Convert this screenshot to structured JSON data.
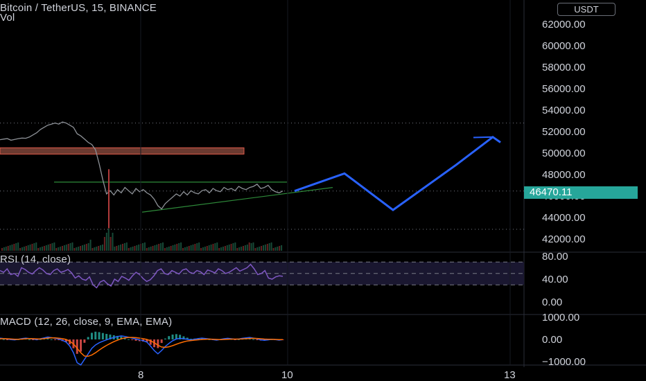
{
  "header": {
    "title": "Bitcoin / TetherUS, 15, BINANCE",
    "volume_label": "Vol",
    "currency_button": "USDT",
    "rsi_label": "RSI (14, close)",
    "macd_label": "MACD (12, 26, close, 9, EMA, EMA)"
  },
  "chart_data": [
    {
      "type": "line",
      "pane": "price",
      "y_ticks": [
        "62000.00",
        "60000.00",
        "58000.00",
        "56000.00",
        "54000.00",
        "52000.00",
        "50000.00",
        "48000.00",
        "46000.00",
        "44000.00",
        "42000.00"
      ],
      "ylim": [
        41500,
        63800
      ],
      "x_ticks": [
        "8",
        "10",
        "13"
      ],
      "last_price": "46470.11",
      "series": [
        {
          "values": [
            51250,
            51300,
            51350,
            51200,
            51280,
            51350,
            51400,
            51380,
            51500,
            51700,
            51900,
            52200,
            52400,
            52600,
            52700,
            52800,
            52700,
            52900,
            52800,
            52600,
            52400,
            51800,
            51600,
            51300,
            51000,
            50800,
            50300,
            49000,
            47500,
            46200,
            46500,
            46100,
            46600,
            46300,
            46800,
            46500,
            46200,
            46700,
            46400,
            46600,
            46300,
            46100,
            45700,
            45100,
            44800,
            45300,
            45600,
            45900,
            46200,
            46000,
            46400,
            46100,
            46500,
            46300,
            46200,
            46500,
            46600,
            46300,
            46700,
            46500,
            46400,
            46800,
            46600,
            46700,
            46500,
            46900,
            46700,
            46600,
            46800,
            46900,
            47100,
            46700,
            46800,
            47000,
            46600,
            46400,
            46300,
            46470
          ]
        }
      ],
      "projection": {
        "color": "#2962ff",
        "points": [
          [
            0,
            46470
          ],
          [
            1,
            48100
          ],
          [
            2,
            44700
          ],
          [
            3,
            48900
          ],
          [
            4,
            51500
          ],
          [
            5,
            51000
          ]
        ]
      },
      "levels": [
        {
          "value": 52800,
          "style": "dotted"
        },
        {
          "value": 46470,
          "style": "dotted"
        },
        {
          "value": 42900,
          "style": "dotted"
        },
        {
          "value": 47300,
          "style": "green"
        }
      ],
      "supply_zone": [
        50100,
        50300
      ],
      "trendline": [
        [
          0.2,
          44500
        ],
        [
          1,
          46800
        ]
      ]
    },
    {
      "type": "line",
      "pane": "rsi",
      "y_ticks": [
        "80.00",
        "40.00",
        "0.00"
      ],
      "band": [
        30,
        70
      ],
      "series": [
        {
          "values": [
            55,
            52,
            58,
            48,
            50,
            45,
            60,
            57,
            52,
            49,
            55,
            60,
            56,
            50,
            48,
            55,
            58,
            52,
            54,
            57,
            51,
            42,
            46,
            40,
            38,
            44,
            30,
            25,
            35,
            38,
            32,
            28,
            40,
            36,
            45,
            42,
            38,
            46,
            52,
            48,
            41,
            36,
            39,
            46,
            55,
            58,
            50,
            48,
            55,
            52,
            49,
            56,
            58,
            52,
            50,
            55,
            53,
            48,
            56,
            54,
            51,
            58,
            55,
            50,
            52,
            56,
            60,
            54,
            57,
            60,
            66,
            58,
            48,
            50,
            55,
            42,
            40,
            44,
            46,
            45
          ]
        }
      ]
    },
    {
      "type": "line",
      "pane": "macd",
      "y_ticks": [
        "1000.00",
        "0.00",
        "−1000.00"
      ],
      "ylim": [
        -1250,
        1250
      ],
      "series": [
        {
          "values": [
            60,
            40,
            20,
            -10,
            -20,
            10,
            40,
            60,
            40,
            20,
            -10,
            30,
            70,
            110,
            80,
            50,
            20,
            -40,
            -120,
            -300,
            -600,
            -1050,
            -1150,
            -900,
            -650,
            -400,
            -250,
            -150,
            -80,
            -20,
            40,
            90,
            130,
            160,
            130,
            100,
            60,
            20,
            -20,
            -60,
            -120,
            -300,
            -500,
            -650,
            -500,
            -320,
            -180,
            -60,
            20,
            50,
            30,
            10,
            -20,
            10,
            40,
            60,
            40,
            20,
            -10,
            -30,
            0,
            30,
            50,
            30,
            10,
            20,
            50,
            70,
            90,
            60,
            30,
            -20,
            -40,
            -20,
            10,
            -10,
            -30,
            -10
          ]
        },
        {
          "values": [
            30,
            35,
            30,
            20,
            10,
            5,
            15,
            30,
            40,
            35,
            25,
            20,
            35,
            60,
            75,
            70,
            55,
            35,
            0,
            -80,
            -200,
            -400,
            -600,
            -750,
            -760,
            -700,
            -600,
            -480,
            -370,
            -270,
            -180,
            -100,
            -30,
            30,
            70,
            90,
            90,
            80,
            60,
            35,
            0,
            -60,
            -150,
            -260,
            -340,
            -360,
            -330,
            -280,
            -220,
            -160,
            -110,
            -70,
            -50,
            -30,
            -15,
            0,
            10,
            15,
            10,
            0,
            -5,
            0,
            10,
            15,
            15,
            15,
            25,
            35,
            45,
            50,
            45,
            30,
            15,
            5,
            5,
            0,
            -5,
            -5
          ]
        }
      ]
    }
  ]
}
